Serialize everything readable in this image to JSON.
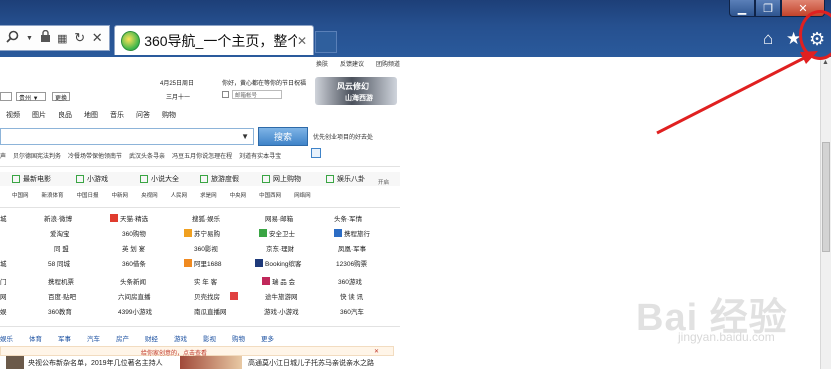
{
  "tab": {
    "title": "360导航_一个主页，整个世...",
    "close": "✕"
  },
  "toolbar": {
    "search_icon": "search-icon",
    "lock_icon": "lock-icon",
    "reload": "↻",
    "stop": "✕"
  },
  "window": {
    "minimize": "▁",
    "maximize": "❐",
    "close": "✕"
  },
  "right_icons": {
    "home": "⌂",
    "star": "★",
    "gear": "⚙"
  },
  "page": {
    "top_links": [
      "换肤",
      "反馈建议",
      "团购频道"
    ],
    "date": "4月25日周日",
    "lunar": "三月十一",
    "weather_tip": "你好，黄心都在等你的节日祝福",
    "mail_placeholder": "邮箱帐号",
    "region_1": "",
    "region_2": "贵州",
    "region_btn": "更换",
    "banner_text": "风云修幻",
    "banner_sub": "山海西游",
    "nav": [
      "视频",
      "图片",
      "良品",
      "地图",
      "音乐",
      "问答",
      "购物"
    ],
    "search_btn": "搜索",
    "search_tip": "优先创业项目的好去处",
    "hot_searches": [
      "声",
      "贝尔德国宪法判务",
      "冷餐场带保他领南节",
      "武汉头条寻亲",
      "冯豆五月你说怎理在程",
      "刘道有实本寻宝"
    ],
    "apps": [
      "最新电影",
      "小游戏",
      "小说大全",
      "旅游度假",
      "网上购物",
      "娱乐八卦"
    ],
    "apps_extra": "开启",
    "sub_links": [
      "中国网",
      "新浪体育",
      "中国日报",
      "中新网",
      "央视网",
      "人民网",
      "求是网",
      "中央网",
      "中国西网",
      "网络网"
    ],
    "grid": [
      [
        "城",
        "新浪·微博",
        "天猫·精选",
        "搜狐·娱乐",
        "网易·邮箱",
        "头条·军情"
      ],
      [
        "",
        "爱淘宝",
        "360购物",
        "苏宁易购",
        "安全卫士",
        "携程旅行"
      ],
      [
        "",
        "同 盟",
        "英 划 宴",
        "360影视",
        "京东·理财",
        "凤凰·军事"
      ],
      [
        "",
        "58 同城",
        "360借条",
        "阿里1688",
        "Booking缤客",
        "12306购票"
      ],
      [
        "",
        "携程机票",
        "头条新闻",
        "实 年 客",
        "瑞 品 会",
        "360游戏"
      ],
      [
        "",
        "百度·贴吧",
        "六间房直播",
        "贝壳找房",
        "途牛旅游网",
        "快 读 讯"
      ],
      [
        "",
        "360教育",
        "4399小游戏",
        "南瓜直播网",
        "游戏·小游戏",
        "360汽车"
      ]
    ],
    "categories": [
      "娱乐",
      "体育",
      "军事",
      "汽车",
      "房产",
      "财经",
      "游戏",
      "影视",
      "购物",
      "更多"
    ],
    "ad_text": "给你家创意的，点击查看",
    "ad_close": "✕",
    "news_1": "央视公布新杂名单，2019年几位著名主持人",
    "news_2": "高通莫小江日城儿子托苏马亲说亲水之路"
  },
  "watermark": {
    "main": "Bai 经验",
    "sub": "jingyan.baidu.com"
  },
  "colors": {
    "chrome": "#26508f",
    "annotation": "#e02020",
    "search_btn": "#3f83c8"
  }
}
